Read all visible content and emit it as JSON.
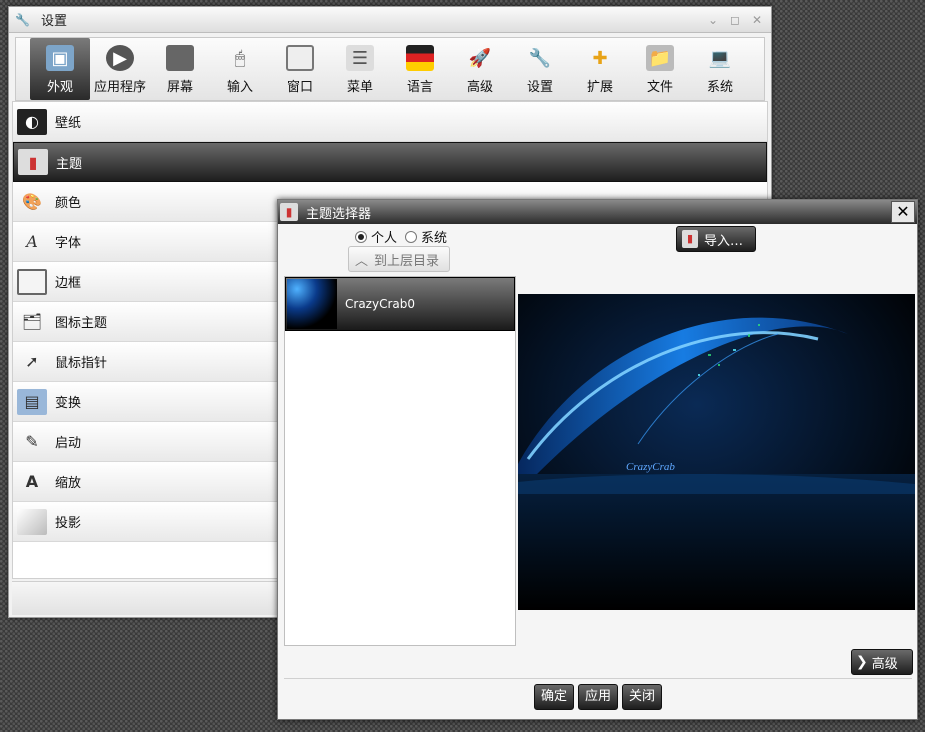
{
  "settings": {
    "title": "设置",
    "toolbar": [
      {
        "label": "外观",
        "icon": "appearance-icon"
      },
      {
        "label": "应用程序",
        "icon": "applications-icon"
      },
      {
        "label": "屏幕",
        "icon": "screen-icon"
      },
      {
        "label": "输入",
        "icon": "input-icon"
      },
      {
        "label": "窗口",
        "icon": "window-icon"
      },
      {
        "label": "菜单",
        "icon": "menu-icon"
      },
      {
        "label": "语言",
        "icon": "language-icon"
      },
      {
        "label": "高级",
        "icon": "advanced-icon"
      },
      {
        "label": "设置",
        "icon": "settings-wrench-icon"
      },
      {
        "label": "扩展",
        "icon": "extensions-icon"
      },
      {
        "label": "文件",
        "icon": "files-icon"
      },
      {
        "label": "系统",
        "icon": "system-icon"
      }
    ],
    "active_tab": "外观",
    "list": [
      {
        "label": "壁纸",
        "icon": "wallpaper-icon"
      },
      {
        "label": "主题",
        "icon": "theme-icon"
      },
      {
        "label": "颜色",
        "icon": "colors-icon"
      },
      {
        "label": "字体",
        "icon": "fonts-icon"
      },
      {
        "label": "边框",
        "icon": "borders-icon"
      },
      {
        "label": "图标主题",
        "icon": "icon-theme-icon"
      },
      {
        "label": "鼠标指针",
        "icon": "mouse-cursor-icon"
      },
      {
        "label": "变换",
        "icon": "transitions-icon"
      },
      {
        "label": "启动",
        "icon": "startup-icon"
      },
      {
        "label": "缩放",
        "icon": "scaling-icon"
      },
      {
        "label": "投影",
        "icon": "shadow-icon"
      }
    ],
    "selected_item": "主题"
  },
  "dialog": {
    "title": "主题选择器",
    "radio_personal": "个人",
    "radio_system": "系统",
    "radio_selected": "个人",
    "up_button": "到上层目录",
    "import_button": "导入…",
    "themes": [
      {
        "name": "CrazyCrab0"
      }
    ],
    "advanced_button": "高级",
    "ok_button": "确定",
    "apply_button": "应用",
    "close_button": "关闭",
    "preview_caption": "CrazyCrab"
  },
  "colors": {
    "selection_dark": "#1e1e1e",
    "preview_blue": "#1a8cff"
  }
}
